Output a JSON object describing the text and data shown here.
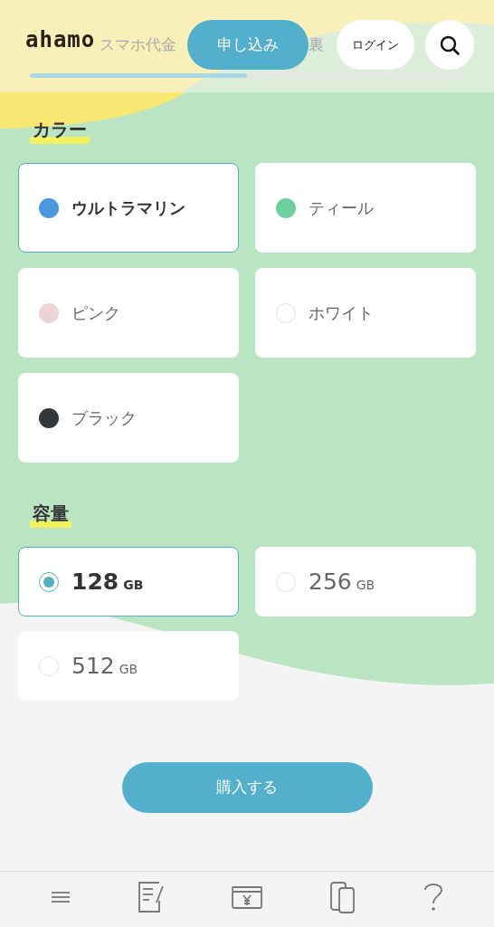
{
  "header": {
    "logo": "ahamo",
    "nav": [
      {
        "label": "スマホ代金",
        "selected": false
      },
      {
        "label": "申し込み",
        "selected": true
      },
      {
        "label": "裏",
        "selected": false
      }
    ],
    "login": "ログイン"
  },
  "color_section": {
    "title": "カラー",
    "options": [
      {
        "label": "ウルトラマリン",
        "color": "#4a98e0",
        "selected": true
      },
      {
        "label": "ティール",
        "color": "#6cd09c",
        "selected": false
      },
      {
        "label": "ピンク",
        "color": "#ecd3d8",
        "selected": false
      },
      {
        "label": "ホワイト",
        "color": "#ffffff",
        "selected": false
      },
      {
        "label": "ブラック",
        "color": "#33373a",
        "selected": false
      }
    ]
  },
  "capacity_section": {
    "title": "容量",
    "options": [
      {
        "value": "128",
        "unit": "GB",
        "selected": true
      },
      {
        "value": "256",
        "unit": "GB",
        "selected": false
      },
      {
        "value": "512",
        "unit": "GB",
        "selected": false
      }
    ]
  },
  "purchase_button": "購入する",
  "bottom_nav": [
    {
      "kind": "menu"
    },
    {
      "kind": "document"
    },
    {
      "kind": "payment"
    },
    {
      "kind": "devices"
    },
    {
      "kind": "help"
    }
  ]
}
